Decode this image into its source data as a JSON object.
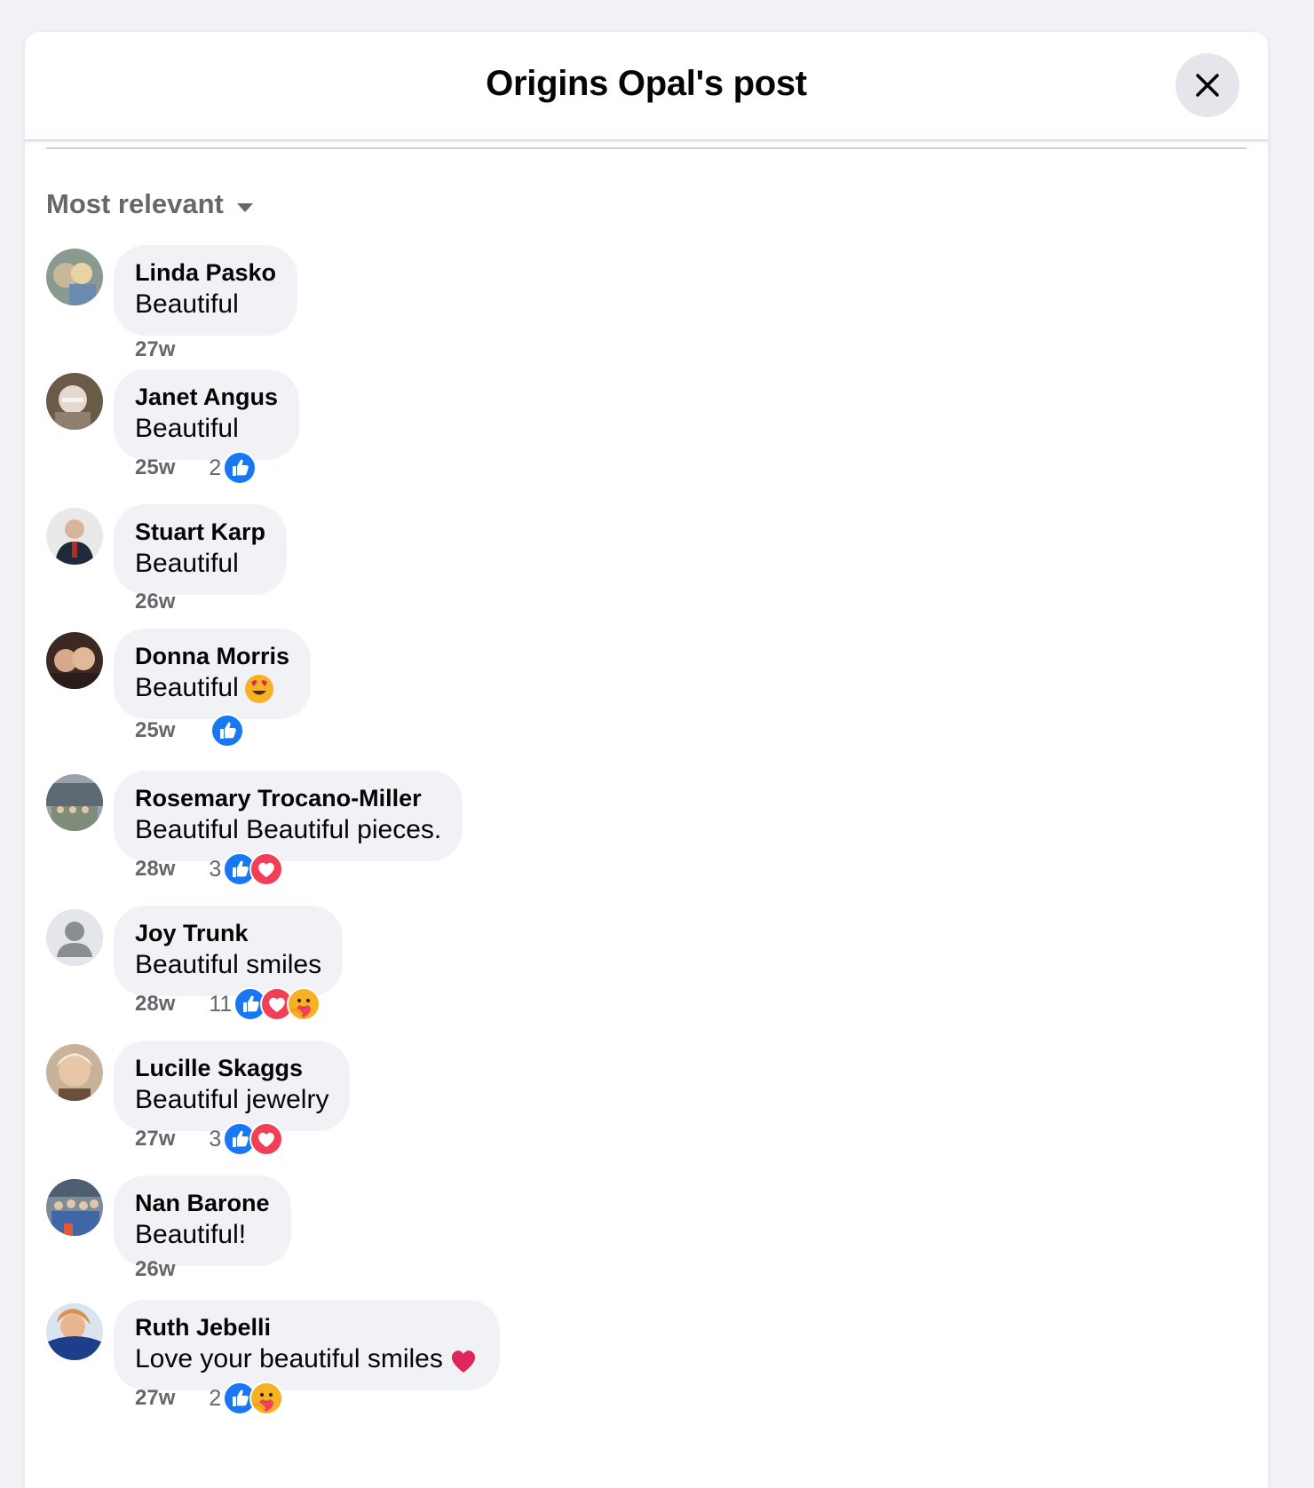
{
  "modal": {
    "title": "Origins Opal's post",
    "close_icon": "close-x-icon"
  },
  "sort": {
    "label": "Most relevant",
    "icon": "caret-down-icon"
  },
  "colors": {
    "like_blue": "#1877f2",
    "love_red": "#f33e58",
    "care_yellow": "#f7b125",
    "meta_gray": "#65676b",
    "bubble_bg": "#f0f2f5"
  },
  "comments": [
    {
      "name": "Linda Pasko",
      "text": "Beautiful",
      "time": "27w",
      "reaction_count": "",
      "reactions": []
    },
    {
      "name": "Janet Angus",
      "text": "Beautiful",
      "time": "25w",
      "reaction_count": "2",
      "reactions": [
        "like"
      ]
    },
    {
      "name": "Stuart Karp",
      "text": "Beautiful",
      "time": "26w",
      "reaction_count": "",
      "reactions": []
    },
    {
      "name": "Donna Morris",
      "text": "Beautiful",
      "text_emoji": "heart-eyes-emoji",
      "time": "25w",
      "reaction_count": "",
      "reactions": [
        "like"
      ]
    },
    {
      "name": "Rosemary Trocano-Miller",
      "text": "Beautiful Beautiful pieces.",
      "time": "28w",
      "reaction_count": "3",
      "reactions": [
        "like",
        "love"
      ]
    },
    {
      "name": "Joy Trunk",
      "text": "Beautiful smiles",
      "time": "28w",
      "reaction_count": "11",
      "reactions": [
        "like",
        "love",
        "care"
      ]
    },
    {
      "name": "Lucille Skaggs",
      "text": "Beautiful jewelry",
      "time": "27w",
      "reaction_count": "3",
      "reactions": [
        "like",
        "love"
      ]
    },
    {
      "name": "Nan Barone",
      "text": "Beautiful!",
      "time": "26w",
      "reaction_count": "",
      "reactions": []
    },
    {
      "name": "Ruth Jebelli",
      "text": "Love your beautiful smiles",
      "text_emoji": "red-heart-emoji",
      "time": "27w",
      "reaction_count": "2",
      "reactions": [
        "like",
        "care"
      ]
    }
  ]
}
